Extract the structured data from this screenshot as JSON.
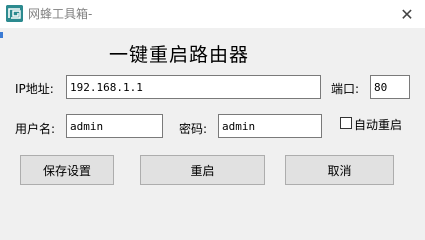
{
  "window": {
    "title": "网蜂工具箱-",
    "app_icon": "app-logo-icon",
    "close_glyph": "✕",
    "heading": "一键重启路由器"
  },
  "form": {
    "ip_label": "IP地址:",
    "ip_value": "192.168.1.1",
    "port_label": "端口:",
    "port_value": "80",
    "username_label": "用户名:",
    "username_value": "admin",
    "password_label": "密码:",
    "password_value": "admin",
    "auto_restart_label": "自动重启",
    "auto_restart_checked": false
  },
  "buttons": {
    "save": "保存设置",
    "restart": "重启",
    "cancel": "取消"
  },
  "colors": {
    "window_bg": "#f0f0f0",
    "titlebar_bg": "#ffffff",
    "icon_bg": "#2c8a8f",
    "button_bg": "#e1e1e1"
  }
}
